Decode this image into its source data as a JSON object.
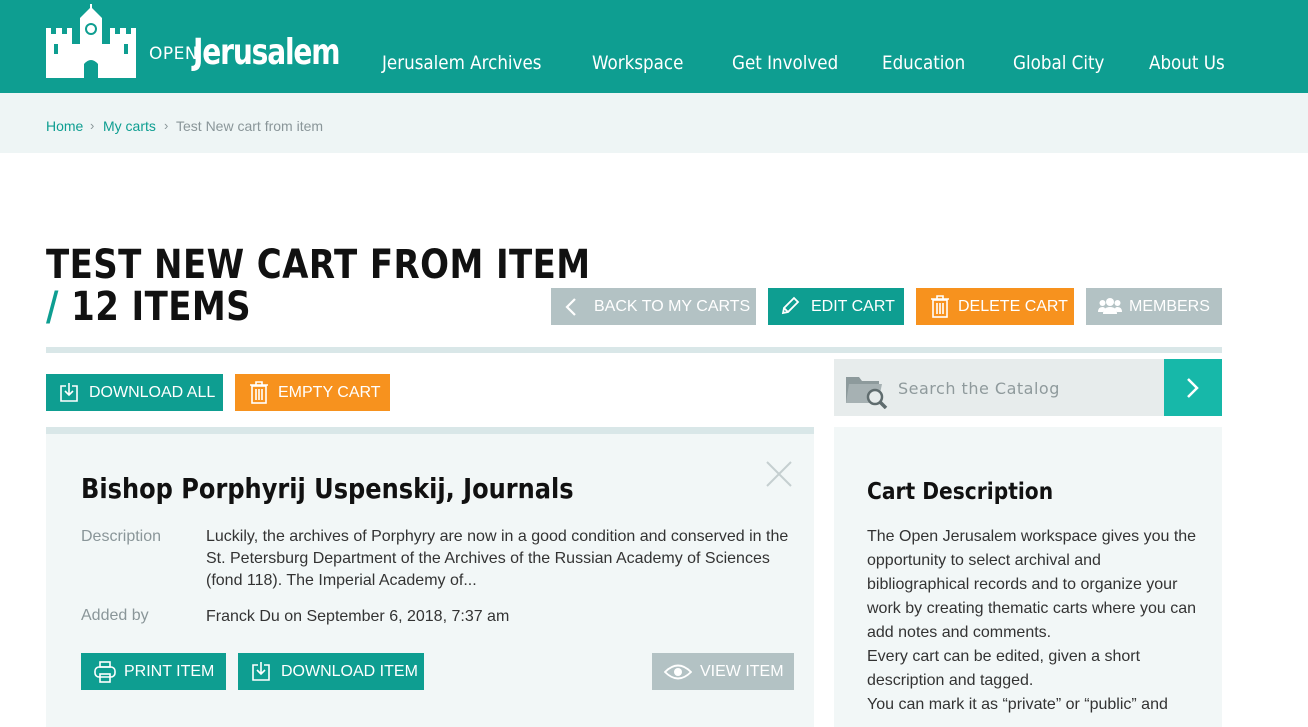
{
  "header": {
    "logo_open": "OPEN",
    "logo_name": "Jerusalem",
    "nav": [
      "Jerusalem Archives",
      "Workspace",
      "Get Involved",
      "Education",
      "Global City",
      "About Us"
    ]
  },
  "breadcrumb": {
    "home": "Home",
    "carts": "My carts",
    "current": "Test New cart from item",
    "separator": "›"
  },
  "cart": {
    "title": "TEST NEW CART FROM ITEM",
    "slash": "/",
    "count": "12 ITEMS",
    "actions": {
      "back": "BACK TO MY CARTS",
      "edit": "EDIT CART",
      "delete": "DELETE CART",
      "members": "MEMBERS"
    },
    "download_all": "DOWNLOAD ALL",
    "empty_cart": "EMPTY CART"
  },
  "search": {
    "placeholder": "Search the Catalog"
  },
  "item": {
    "title": "Bishop Porphyrij Uspenskij, Journals",
    "description_label": "Description",
    "description": "Luckily, the archives of Porphyry are now in a good condition and conserved in the St. Petersburg Department of the Archives of the Russian Academy of Sciences (fond 118). The Imperial Academy of...",
    "added_by_label": "Added by",
    "added_by": "Franck Du on September 6, 2018, 7:37 am",
    "print": "PRINT ITEM",
    "download": "DOWNLOAD ITEM",
    "view": "VIEW ITEM"
  },
  "sidebar": {
    "title": "Cart Description",
    "paragraphs": [
      "The Open Jerusalem workspace gives you the opportunity to select archival and bibliographical records and to organize your work by creating thematic carts where you can add notes and comments.",
      "Every cart can be edited, given a short description and tagged.",
      "You can mark it as “private” or “public” and"
    ]
  },
  "colors": {
    "teal": "#0e9e91",
    "teal_light": "#17b8a9",
    "orange": "#f7921e",
    "gray_button": "#b3c2c4",
    "breadcrumb_bg": "#eef5f5"
  }
}
